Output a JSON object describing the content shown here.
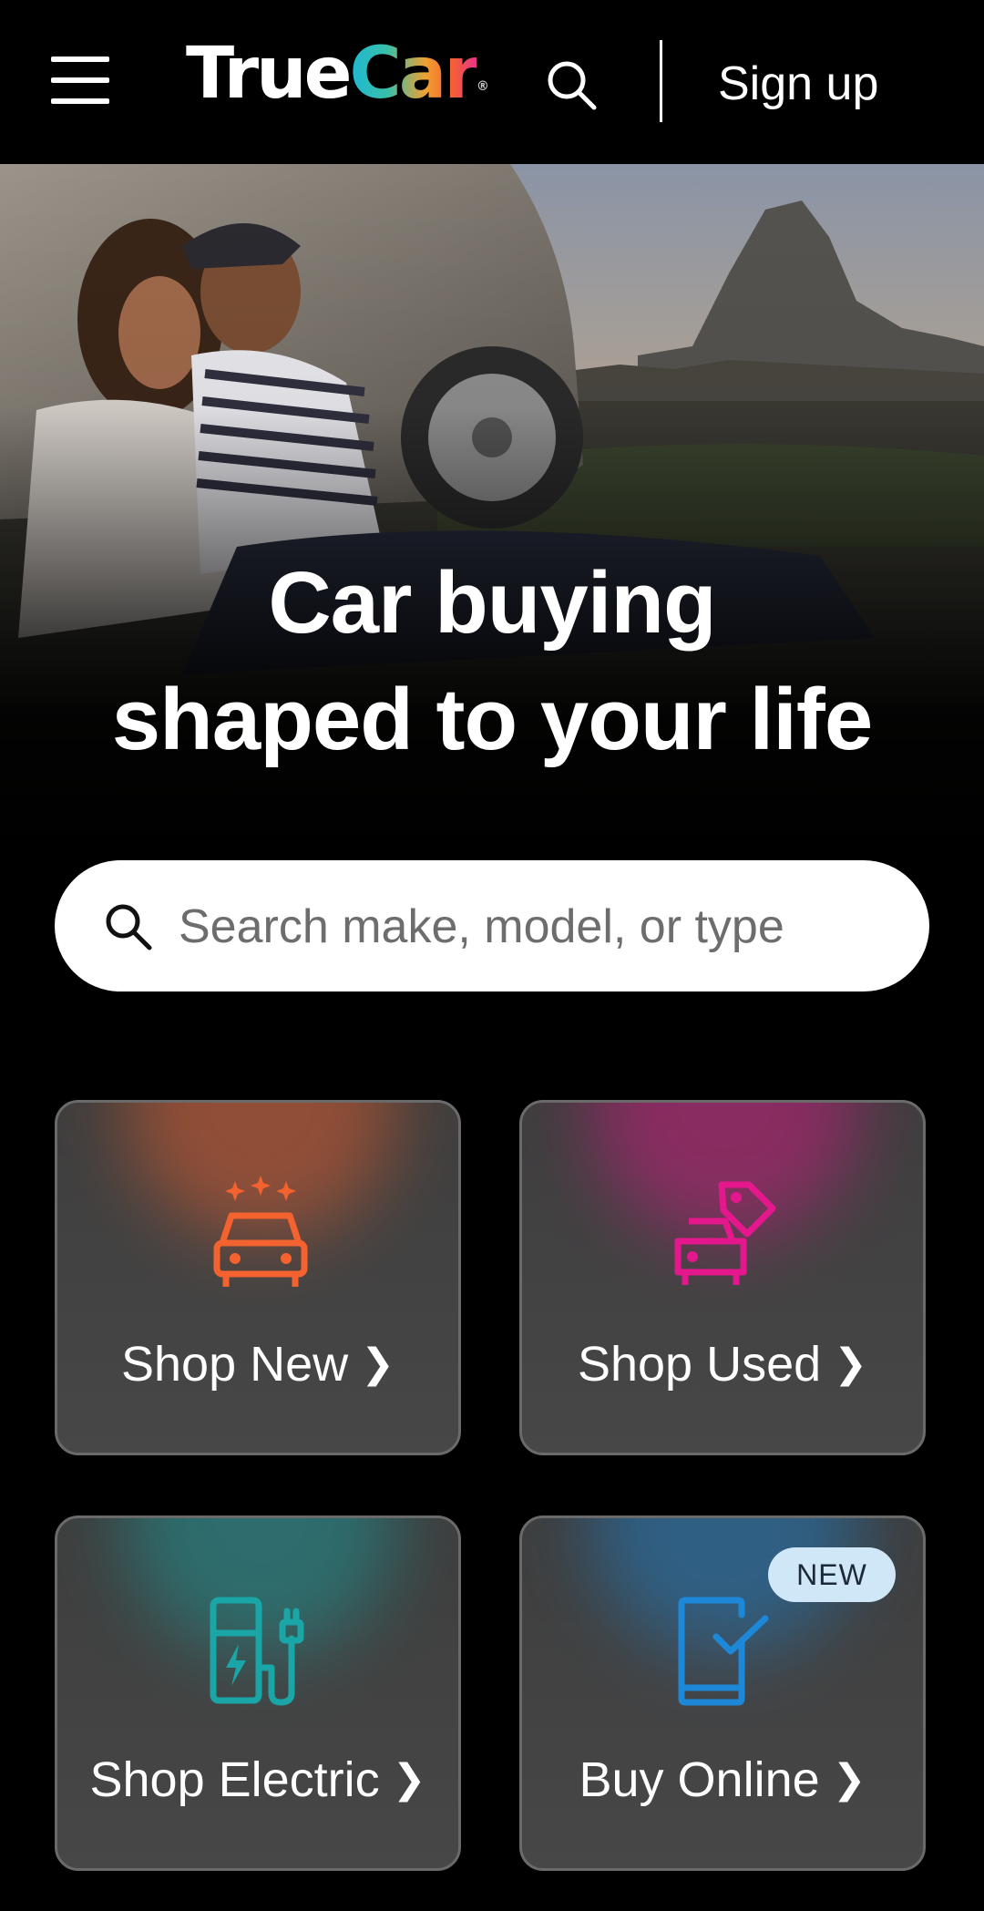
{
  "header": {
    "logo": {
      "part1": "True",
      "part2": "Car",
      "reg": "®"
    },
    "signup_label": "Sign up"
  },
  "hero": {
    "title_line1": "Car buying",
    "title_line2": "shaped to your life"
  },
  "search": {
    "placeholder": "Search make, model, or type"
  },
  "tiles": [
    {
      "label": "Shop New",
      "icon": "car-sparkle-icon",
      "color": "#f4622f"
    },
    {
      "label": "Shop Used",
      "icon": "car-tag-icon",
      "color": "#e4178c"
    },
    {
      "label": "Shop Electric",
      "icon": "ev-charger-icon",
      "color": "#1aa6a6"
    },
    {
      "label": "Buy Online",
      "icon": "phone-check-icon",
      "color": "#1e88d8",
      "badge": "NEW"
    }
  ],
  "colors": {
    "background": "#000000",
    "tile_bg": "#444444",
    "badge_bg": "#cfe7f7"
  }
}
